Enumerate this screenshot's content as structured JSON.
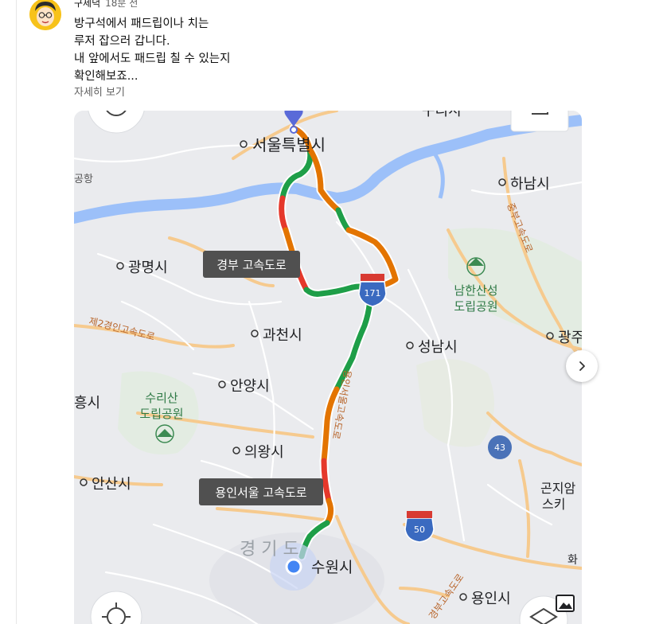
{
  "comment": {
    "author": "구제덕",
    "time": "18분 전",
    "lines": [
      "방구석에서 패드립이나 치는",
      "루저 잡으러 갑니다.",
      "내 앞에서도 패드립 칠 수 있는지",
      "확인해보죠..."
    ],
    "more_label": "자세히 보기"
  },
  "map": {
    "places": {
      "seoul": "서울특별시",
      "hanam": "하남시",
      "gwangmyeong": "광명시",
      "namhansanseong": "남한산성",
      "namhansanseong_park": "도립공원",
      "gwacheon": "과천시",
      "seongnam": "성남시",
      "gwangju": "광주",
      "anyang": "안양시",
      "heungsi": "흥시",
      "surisan": "수리산",
      "surisan_park": "도립공원",
      "uiwang": "의왕시",
      "ansan": "안산시",
      "gonjiam": "곤지암",
      "seu": "스키",
      "suwon": "수원시",
      "yongin": "용인시",
      "gyeonggido": "경 기 도",
      "hwa": "화",
      "top_partial": "구리시",
      "gonghang": "공항"
    },
    "road_labels": {
      "gyeongbu": "경부 고속도로",
      "yongin_seoul": "용인서울 고속도로",
      "second_gyeongin": "제2경인고속도로",
      "jungbu": "중부고속도로",
      "yongin_seoul_vertical": "용인서울고속도로",
      "gyeongbu_lower": "경부고속도로"
    },
    "shields": {
      "r171": "171",
      "r43": "43",
      "r50": "50"
    },
    "colors": {
      "background": "#eaebee",
      "river": "#9cc0f9",
      "highway": "#f6ca8e",
      "route_green": "#1e9e48",
      "route_orange": "#e37400",
      "route_red": "#e5382b"
    }
  }
}
